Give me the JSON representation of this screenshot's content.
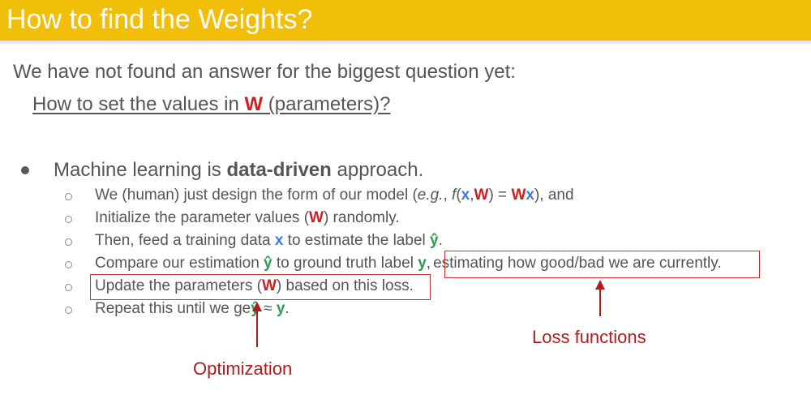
{
  "slide": {
    "title": "How to find the Weights?",
    "intro": "We have not found an answer for the biggest question yet:",
    "question": {
      "before": "How to set the values in ",
      "w": "W",
      "after": " (parameters)?"
    },
    "bullet": {
      "before": "Machine learning is ",
      "bold": "data-driven",
      "after": " approach."
    },
    "items": {
      "s1": {
        "a": "We (human) just design the form of our model (",
        "eg": "e.g.",
        "b": ", ",
        "f": "f",
        "c": "(",
        "x": "x",
        "d": ",",
        "w": "W",
        "e": ") = ",
        "w2": "W",
        "x2": "x",
        "g": "), and"
      },
      "s2": {
        "a": "Initialize the parameter values (",
        "w": "W",
        "b": ") randomly."
      },
      "s3": {
        "a": "Then, feed a training data ",
        "x": "x",
        "b": " to estimate the label ",
        "yhat": "ŷ",
        "c": "."
      },
      "s4": {
        "a": "Compare our estimation ",
        "yhat": "ŷ",
        "b": " to ground truth label ",
        "y": "y",
        "c": ",",
        "boxed": "estimating how good/bad we are currently."
      },
      "s5": {
        "a": "Update the parameters (",
        "w": "W",
        "b": ") based on this loss."
      },
      "s6": {
        "a": "Repeat this until we ge",
        "yhat": "ŷ",
        "b": " ≈ ",
        "y": "y",
        "c": "."
      }
    },
    "annotations": {
      "loss": "Loss functions",
      "optimization": "Optimization"
    }
  },
  "colors": {
    "title_bar": "#f1be0a",
    "param_red": "#cc1f1f",
    "input_blue": "#3d7cd6",
    "label_green": "#2e9b52",
    "annotation_red": "#b01c1c"
  }
}
